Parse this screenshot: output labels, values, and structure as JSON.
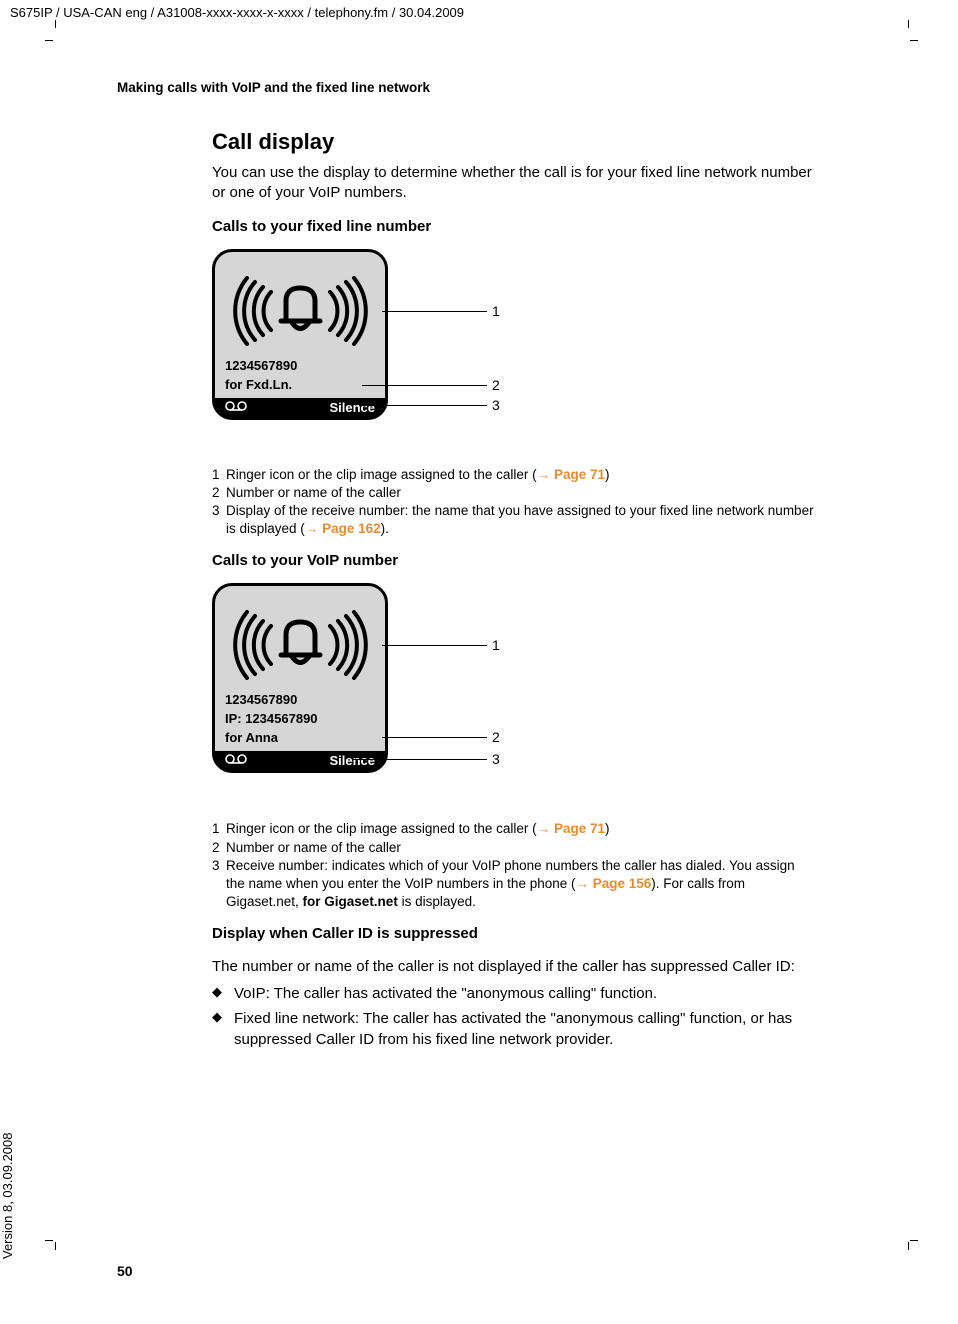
{
  "header": "S675IP  / USA-CAN eng / A31008-xxxx-xxxx-x-xxxx / telephony.fm / 30.04.2009",
  "side_version": "Version 8, 03.09.2008",
  "running_head": "Making calls with VoIP and the fixed line network",
  "h2": "Call display",
  "intro": "You can use the display to determine whether the call is for your fixed line network number or one of your VoIP numbers.",
  "sec1_h": "Calls to your fixed line number",
  "fig1": {
    "num": "1234567890",
    "for": "for Fxd.Ln.",
    "silence": "Silence",
    "vm": "Ø",
    "c1": "1",
    "c2": "2",
    "c3": "3"
  },
  "legend1": {
    "r1n": "1",
    "r1t": "Ringer icon or the clip image assigned to the caller (",
    "r1a": "→",
    "r1p": "Page 71",
    "r1e": ")",
    "r2n": "2",
    "r2t": "Number or name of the caller",
    "r3n": "3",
    "r3t": "Display of the receive number: the name that you have assigned to your fixed line network number is displayed (",
    "r3a": "→",
    "r3p": "Page 162",
    "r3e": ")."
  },
  "sec2_h": "Calls to your VoIP number",
  "fig2": {
    "num": "1234567890",
    "ip": " IP: 1234567890",
    "for": "for Anna",
    "silence": "Silence",
    "vm": "Ø",
    "c1": "1",
    "c2": "2",
    "c3": "3"
  },
  "legend2": {
    "r1n": "1",
    "r1t": "Ringer icon or the clip image assigned to the caller (",
    "r1a": "→",
    "r1p": "Page 71",
    "r1e": ")",
    "r2n": "2",
    "r2t": "Number or name of the caller",
    "r3n": "3",
    "r3t": "Receive number: indicates which of your VoIP phone numbers the caller has dialed. You assign the name when you enter the VoIP numbers in the phone (",
    "r3a": "→",
    "r3p": "Page 156",
    "r3e": "). For calls from Gigaset.net, ",
    "r3g": "for Gigaset.net",
    "r3t2": " is displayed."
  },
  "sec3_h": "Display when Caller ID is suppressed",
  "sec3_p": "The number or name of the caller is not displayed if the caller has suppressed Caller ID:",
  "bul1": "VoIP: The caller has activated the \"anonymous calling\" function.",
  "bul2": "Fixed line network: The caller has activated the \"anonymous calling\" function, or has suppressed Caller ID from his fixed line network provider.",
  "bm": "◆",
  "page_num": "50"
}
